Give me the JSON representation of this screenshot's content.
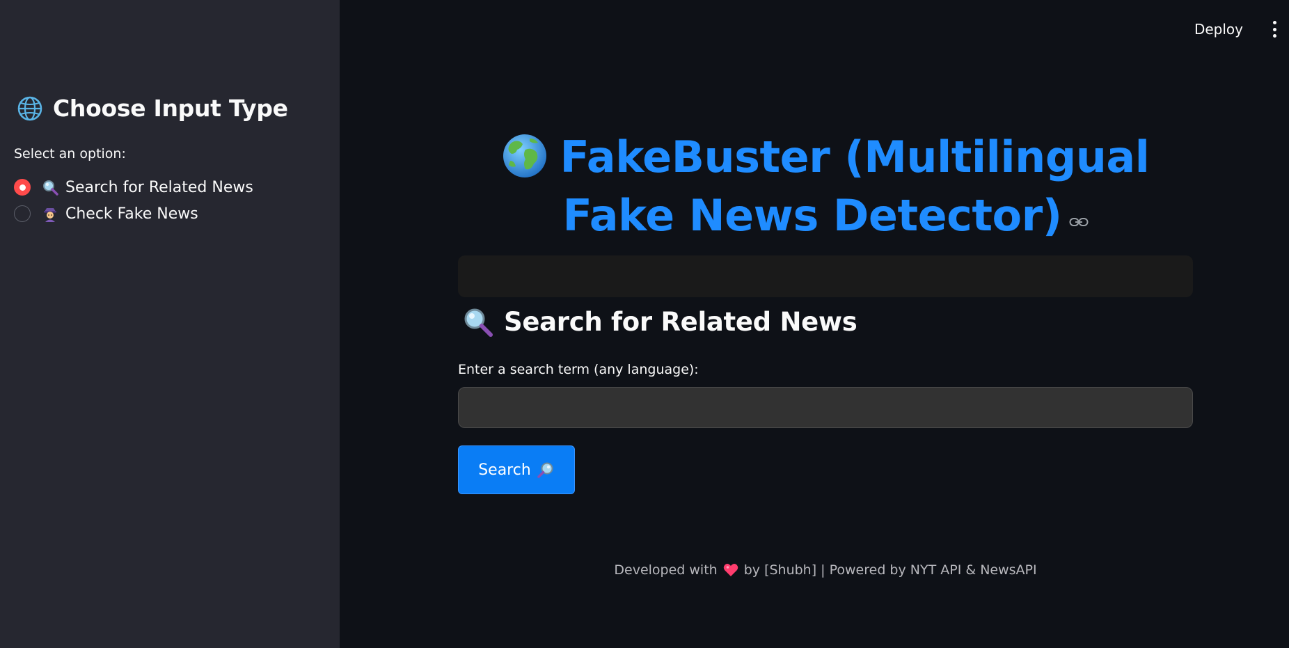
{
  "header": {
    "deploy_label": "Deploy",
    "menu_icon": "vertical-ellipsis-icon"
  },
  "sidebar": {
    "title": "Choose Input Type",
    "title_icon": "globe-meridian-icon",
    "select_label": "Select an option:",
    "options": [
      {
        "label": "Search for Related News",
        "icon": "magnifier-icon",
        "selected": true
      },
      {
        "label": "Check Fake News",
        "icon": "detective-icon",
        "selected": false
      }
    ]
  },
  "main": {
    "title": "FakeBuster (Multilingual Fake News Detector)",
    "title_icon": "earth-globe-icon",
    "section_title": "Search for Related News",
    "section_icon": "magnifier-icon",
    "search_label": "Enter a search term (any language):",
    "search_value": "",
    "search_button_label": "Search",
    "search_button_icon": "magnifier-right-icon"
  },
  "footer": {
    "prefix": "Developed with",
    "heart_icon": "heart-icon",
    "suffix": "by [Shubh] | Powered by NYT API & NewsAPI"
  },
  "colors": {
    "main_bg": "#0e1117",
    "sidebar_bg": "#262730",
    "title_blue": "#1f8cff",
    "button_blue": "#0a7df5",
    "radio_selected": "#ff4b4b",
    "heart": "#ff3d6e"
  }
}
